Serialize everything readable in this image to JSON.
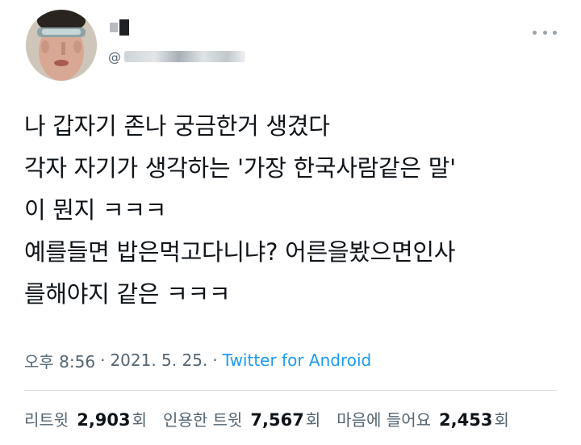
{
  "author": {
    "display_name": "",
    "handle": "@"
  },
  "tweet": {
    "lines": [
      "나 갑자기 존나 궁금한거 생겼다",
      "각자 자기가 생각하는 '가장 한국사람같은 말'",
      "이 뭔지 ㅋㅋㅋ",
      "예를들면 밥은먹고다니냐? 어른을봤으면인사",
      "를해야지 같은 ㅋㅋㅋ"
    ],
    "time": "오후 8:56",
    "separator": "·",
    "date": "2021. 5. 25.",
    "source": "Twitter for Android"
  },
  "stats": {
    "retweets": {
      "label": "리트윗",
      "count": "2,903",
      "unit": "회"
    },
    "quotes": {
      "label": "인용한 트윗",
      "count": "7,567",
      "unit": "회"
    },
    "likes": {
      "label": "마음에 들어요",
      "count": "2,453",
      "unit": "회"
    }
  },
  "colors": {
    "text": "#0f1419",
    "secondary": "#536471",
    "link": "#1d9bf0"
  }
}
